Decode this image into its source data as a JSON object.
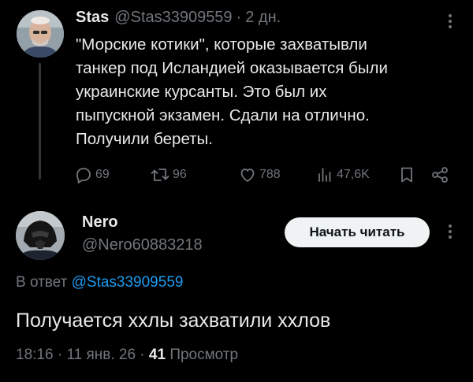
{
  "parent_tweet": {
    "author_name": "Stas",
    "author_handle": "@Stas33909559",
    "separator": "·",
    "time_ago": "2 дн.",
    "text": "\"Морские котики\", которые захватывли\nтанкер под Исландией оказывается были\nукраинские курсанты. Это был их\nпыпускной экзамен. Сдали на отлично.\nПолучили береты.",
    "replies": "69",
    "reposts": "96",
    "likes": "788",
    "views": "47,6K",
    "icons": {
      "reply": "reply-icon",
      "repost": "repost-icon",
      "like": "heart-icon",
      "views": "views-icon",
      "bookmark": "bookmark-icon",
      "share": "share-icon",
      "more": "more-icon"
    }
  },
  "reply_tweet": {
    "author_name": "Nero",
    "author_handle": "@Nero60883218",
    "follow_label": "Начать читать",
    "reply_prefix": "В ответ",
    "reply_mention": "@Stas33909559",
    "text": "Получается ххлы захватили ххлов",
    "time": "18:16",
    "date": "11 янв. 26",
    "separator": "·",
    "views_count": "41",
    "views_label": "Просмотр"
  },
  "colors": {
    "background": "#000000",
    "text": "#e7e9ea",
    "muted": "#71767b",
    "link": "#1d9bf0",
    "button_bg": "#eff3f4",
    "button_text": "#0f1419",
    "thread_line": "#333639"
  }
}
